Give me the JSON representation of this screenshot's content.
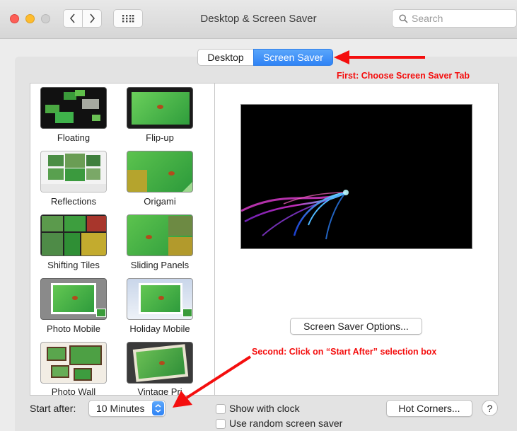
{
  "window": {
    "title": "Desktop & Screen Saver"
  },
  "toolbar": {
    "search_placeholder": "Search"
  },
  "tabs": [
    {
      "label": "Desktop",
      "selected": false
    },
    {
      "label": "Screen Saver",
      "selected": true
    }
  ],
  "screensavers": [
    {
      "label": "Floating"
    },
    {
      "label": "Flip-up"
    },
    {
      "label": "Reflections"
    },
    {
      "label": "Origami"
    },
    {
      "label": "Shifting Tiles"
    },
    {
      "label": "Sliding Panels"
    },
    {
      "label": "Photo Mobile"
    },
    {
      "label": "Holiday Mobile"
    },
    {
      "label": "Photo Wall"
    },
    {
      "label": "Vintage Pri"
    }
  ],
  "preview": {
    "options_label": "Screen Saver Options..."
  },
  "footer": {
    "start_after_label": "Start after:",
    "start_after_value": "10 Minutes",
    "show_clock_label": "Show with clock",
    "random_label": "Use random screen saver",
    "hot_corners_label": "Hot Corners...",
    "help_label": "?"
  },
  "annotations": {
    "first": "First: Choose Screen Saver Tab",
    "second": "Second: Click on “Start After” selection box"
  },
  "colors": {
    "accent": "#3b8cf7",
    "annotation": "#f40e0e",
    "close": "#fd5f57",
    "minimize": "#febc2e",
    "zoom": "#c8c8c8"
  }
}
